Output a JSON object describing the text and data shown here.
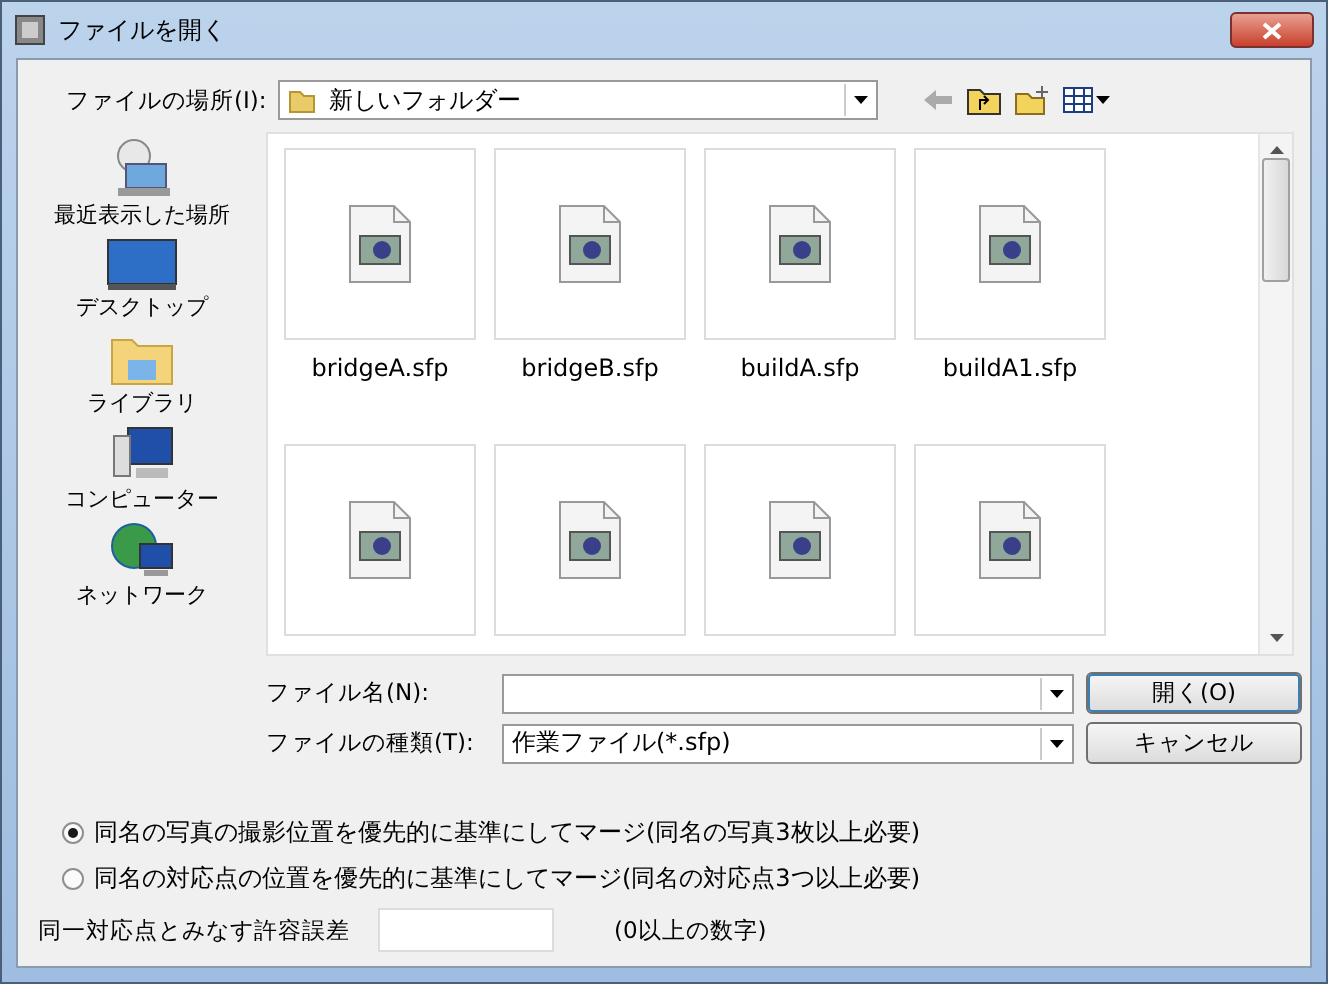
{
  "window": {
    "title": "ファイルを開く"
  },
  "location": {
    "label": "ファイルの場所(I):",
    "value": "新しいフォルダー"
  },
  "places": [
    {
      "kind": "recent",
      "label": "最近表示した場所"
    },
    {
      "kind": "desktop",
      "label": "デスクトップ"
    },
    {
      "kind": "library",
      "label": "ライブラリ"
    },
    {
      "kind": "computer",
      "label": "コンピューター"
    },
    {
      "kind": "network",
      "label": "ネットワーク"
    }
  ],
  "files": [
    {
      "kind": "labeled",
      "name": "bridgeA.sfp"
    },
    {
      "kind": "labeled",
      "name": "bridgeB.sfp"
    },
    {
      "kind": "labeled",
      "name": "buildA.sfp"
    },
    {
      "kind": "labeled",
      "name": "buildA1.sfp"
    },
    {
      "kind": "label_cut_off"
    },
    {
      "kind": "label_cut_off"
    },
    {
      "kind": "label_cut_off"
    },
    {
      "kind": "label_cut_off"
    }
  ],
  "file_name": {
    "label": "ファイル名(N):"
  },
  "file_type": {
    "label": "ファイルの種類(T):",
    "value": "作業ファイル(*.sfp)"
  },
  "buttons": [
    "開く(O)",
    "キャンセル"
  ],
  "merge_options": [
    {
      "label": "同名の写真の撮影位置を優先的に基準にしてマージ(同名の写真3枚以上必要)",
      "selected": true
    },
    {
      "label": "同名の対応点の位置を優先的に基準にしてマージ(同名の対応点3つ以上必要)",
      "selected": false
    }
  ],
  "tolerance": {
    "label": "同一対応点とみなす許容誤差",
    "note": "(0以上の数字)"
  }
}
